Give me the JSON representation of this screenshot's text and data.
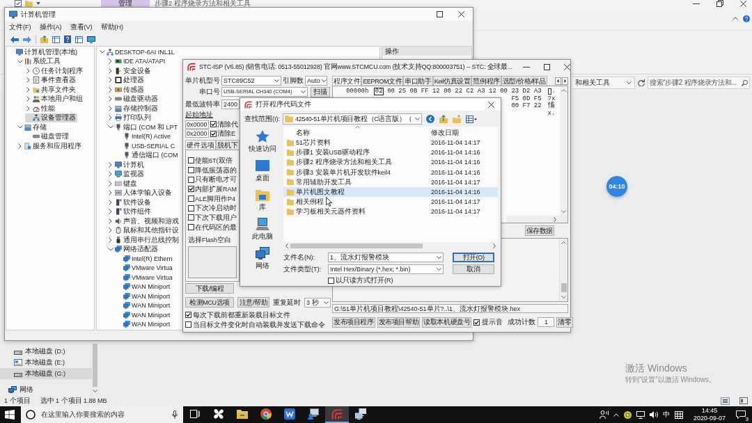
{
  "explorer": {
    "title": "步骤2 程序烧录方法和相关工具",
    "context_tab": "管理",
    "address_text": "和相关工具",
    "search": {
      "placeholder": "搜索“步骤2 程序烧录方法和..."
    },
    "nav_items": [
      {
        "label": "本地磁盘 (D:)",
        "kind": "disk",
        "selected": false
      },
      {
        "label": "本地磁盘 (E:)",
        "kind": "drive",
        "selected": false
      },
      {
        "label": "本地磁盘 (G:)",
        "kind": "disk",
        "selected": true
      },
      {
        "label": "网络",
        "kind": "network",
        "selected": false
      }
    ],
    "status": [
      "1 个项目",
      "选中 1 个项目  1.88 MB"
    ]
  },
  "computer_management": {
    "title": "计算机管理",
    "menu": [
      "文件(F)",
      "操作(A)",
      "查看(V)",
      "帮助(H)"
    ],
    "nav_tree": [
      {
        "label": "计算机管理(本地)",
        "kind": "computer",
        "selected": false,
        "children": [
          {
            "label": "系统工具",
            "kind": "tools",
            "expanded": true,
            "selected": false,
            "children": [
              {
                "label": "任务计划程序",
                "kind": "clock",
                "expanded": false,
                "selected": false
              },
              {
                "label": "事件查看器",
                "kind": "log",
                "expanded": false,
                "selected": false
              },
              {
                "label": "共享文件夹",
                "kind": "share",
                "expanded": false,
                "selected": false
              },
              {
                "label": "本地用户和组",
                "kind": "users",
                "expanded": false,
                "selected": false
              },
              {
                "label": "性能",
                "kind": "gauge",
                "expanded": false,
                "selected": false
              },
              {
                "label": "设备管理器",
                "kind": "devices",
                "selected": true
              }
            ]
          },
          {
            "label": "存储",
            "kind": "storage",
            "expanded": true,
            "selected": false,
            "children": [
              {
                "label": "磁盘管理",
                "kind": "disk",
                "selected": false
              }
            ]
          },
          {
            "label": "服务和应用程序",
            "kind": "services",
            "expanded": false,
            "selected": false
          }
        ]
      }
    ],
    "device_tree": [
      {
        "label": "DESKTOP-6AI INL1L",
        "kind": "devices",
        "expanded": true,
        "children": [
          {
            "label": "IDE ATA/ATAPI",
            "kind": "board",
            "expanded": false
          },
          {
            "label": "安全设备",
            "kind": "security",
            "expanded": false
          },
          {
            "label": "处理器",
            "kind": "chip",
            "expanded": false
          },
          {
            "label": "传感器",
            "kind": "sensor",
            "expanded": false
          },
          {
            "label": "磁盘驱动器",
            "kind": "disk",
            "expanded": false
          },
          {
            "label": "存储控制器",
            "kind": "storage",
            "expanded": false
          },
          {
            "label": "打印队列",
            "kind": "printer",
            "expanded": false
          },
          {
            "label": "端口 (COM 和 LPT",
            "kind": "port",
            "expanded": true,
            "children": [
              {
                "label": "Intel(R) Active",
                "kind": "port"
              },
              {
                "label": "USB-SERIAL C",
                "kind": "port"
              },
              {
                "label": "通信端口 (COM",
                "kind": "port"
              }
            ]
          },
          {
            "label": "计算机",
            "kind": "computer",
            "expanded": false
          },
          {
            "label": "监视器",
            "kind": "monitor",
            "expanded": false
          },
          {
            "label": "键盘",
            "kind": "keyboard",
            "expanded": false
          },
          {
            "label": "人体学输入设备",
            "kind": "hid",
            "expanded": false
          },
          {
            "label": "软件设备",
            "kind": "software",
            "expanded": false
          },
          {
            "label": "软件组件",
            "kind": "software",
            "expanded": false
          },
          {
            "label": "声音、视频和游戏",
            "kind": "speaker",
            "expanded": false
          },
          {
            "label": "鼠标和其他指针设",
            "kind": "mouse",
            "expanded": false
          },
          {
            "label": "通用串行总线控制",
            "kind": "usb",
            "expanded": false
          },
          {
            "label": "网络适配器",
            "kind": "network",
            "expanded": true,
            "children": [
              {
                "label": "Intel(R) Ethern",
                "kind": "network"
              },
              {
                "label": "VMware Virtua",
                "kind": "network"
              },
              {
                "label": "VMware Virtua",
                "kind": "network"
              },
              {
                "label": "WAN Miniport",
                "kind": "network"
              },
              {
                "label": "WAN Miniport",
                "kind": "network"
              },
              {
                "label": "WAN Miniport",
                "kind": "network"
              },
              {
                "label": "WAN Miniport",
                "kind": "network"
              },
              {
                "label": "WAN Miniport",
                "kind": "network"
              }
            ]
          }
        ]
      }
    ],
    "actions_header": "操作"
  },
  "stc_isp": {
    "title": "STC-ISP (V6.85) (销售电话: 0513-55012928) 官网www.STCMCU.com (技术支持QQ:800003751) -- STC: 全球最...",
    "mcu": {
      "label": "单片机型号",
      "value": "STC89C52"
    },
    "pins": {
      "label": "引脚数",
      "value": "Auto"
    },
    "port": {
      "label": "串口号",
      "value": "USB-SERIAL CH340 (COM4)",
      "button": "扫描"
    },
    "baud": {
      "label": "最低波特率",
      "value": "2400"
    },
    "address": {
      "label": "起始地址",
      "rows": [
        {
          "value": "0x0000",
          "option": "清除代",
          "checked": true
        },
        {
          "value": "0x2000",
          "option": "清除E",
          "checked": true
        }
      ]
    },
    "option_tabs": [
      {
        "label": "硬件选项",
        "selected": true
      },
      {
        "label": "脱机下",
        "selected": false
      }
    ],
    "hardware_options": [
      {
        "label": "使能6T(双倍",
        "checked": false
      },
      {
        "label": "降低振荡器的",
        "checked": false
      },
      {
        "label": "只有断电才可",
        "checked": false
      },
      {
        "label": "内部扩展RAM",
        "checked": true
      },
      {
        "label": "ALE脚用作P4",
        "checked": false
      },
      {
        "label": "下次冷启动时",
        "checked": false
      },
      {
        "label": "下次下载用户",
        "checked": false
      },
      {
        "label": "在代码区的最",
        "checked": false
      }
    ],
    "flash_fill": "选择Flash空白",
    "download_button": "下载/编程",
    "check_button": "检测MCU选项",
    "help_button": "注意/帮助",
    "repeat": {
      "label": "重复延时",
      "value": "3 秒"
    },
    "reload_options": [
      {
        "label": "每次下载前都重新装载目标文件",
        "checked": true
      },
      {
        "label": "当目标文件变化时自动装载并发送下载命令",
        "checked": false
      }
    ],
    "file_tabs": [
      {
        "label": "程序文件",
        "selected": true
      },
      {
        "label": "EEPROM文件",
        "selected": false
      },
      {
        "label": "串口助手",
        "selected": false
      },
      {
        "label": "Keil仿真设置",
        "selected": false
      },
      {
        "label": "范例程序",
        "selected": false
      },
      {
        "label": "选型/价格/样品",
        "selected": false
      }
    ],
    "hex_rows": [
      {
        "address": "00000h",
        "cursor_byte": "02",
        "bytes": "00 25 0B FF 12 00 22 C2 A3 12 00 23 D2 A3",
        "ascii": "."
      },
      {
        "bytes": "F5 0D F5",
        "ascii": "?x"
      },
      {
        "bytes": "00 F7 22",
        "ascii": "慉"
      },
      {
        "ascii": "x."
      }
    ],
    "save_button": "保存数据",
    "file_path": "G:\\51单片机项目教程\\42540-51单片?..\\1、流水灯报警模块.hex",
    "publish_buttons": [
      "发布项目程序",
      "发布项目帮助",
      "读取本机硬盘号"
    ],
    "beep": {
      "label": "提示音",
      "checked": true
    },
    "counter": {
      "label": "成功计数",
      "value": "1",
      "button": "清零"
    }
  },
  "open_dialog": {
    "title": "打开程序代码文件",
    "look_in": {
      "label": "查找范围(I):",
      "value": "42540-51单片机项目教程（C语言版）（"
    },
    "places": [
      {
        "label": "快速访问",
        "kind": "star"
      },
      {
        "label": "桌面",
        "kind": "desktop"
      },
      {
        "label": "库",
        "kind": "library"
      },
      {
        "label": "此电脑",
        "kind": "computer"
      },
      {
        "label": "网络",
        "kind": "network"
      }
    ],
    "columns": [
      "名称",
      "修改日期"
    ],
    "files": [
      {
        "name": "51芯片资料",
        "modified": "2016-11-04 14:17",
        "selected": false
      },
      {
        "name": "步骤1 安装USB驱动程序",
        "modified": "2016-11-04 14:16",
        "selected": false
      },
      {
        "name": "步骤2 程序烧录方法和相关工具",
        "modified": "2016-11-04 14:16",
        "selected": false
      },
      {
        "name": "步骤3 安装单片机开发软件keil4",
        "modified": "2016-11-04 14:16",
        "selected": false
      },
      {
        "name": "常用辅助开发工具",
        "modified": "2016-11-04 14:17",
        "selected": false
      },
      {
        "name": "单片机图文教程",
        "modified": "2016-11-04 14:16",
        "selected": true
      },
      {
        "name": "相关例程",
        "modified": "2016-11-04 14:17",
        "selected": false
      },
      {
        "name": "学习板相关元器件资料",
        "modified": "2016-11-04 14:17",
        "selected": false
      }
    ],
    "file_name": {
      "label": "文件名(N):",
      "value": "1、流水灯报警模块"
    },
    "file_type": {
      "label": "文件类型(T):",
      "value": "Intel Hex/Binary (*.hex; *.bin)"
    },
    "read_only": {
      "label": "以只读方式打开(R)",
      "checked": false
    },
    "buttons": [
      {
        "label": "打开(O)",
        "kind": "default"
      },
      {
        "label": "取消",
        "kind": "normal"
      }
    ]
  },
  "recording_timer": "04:10",
  "activation_notice": {
    "title": "激活 Windows",
    "hint": "转到“设置”以激活 Windows。"
  },
  "taskbar": {
    "search": {
      "placeholder": "在这里输入你要搜索的内容"
    },
    "apps": [
      {
        "kind": "task-view",
        "active": false
      },
      {
        "kind": "pinwheel",
        "active": false
      },
      {
        "kind": "folder",
        "active": false
      },
      {
        "kind": "browser",
        "active": false
      },
      {
        "kind": "writer",
        "active": false
      },
      {
        "kind": "remote",
        "active": false
      },
      {
        "kind": "stc",
        "active": true
      },
      {
        "kind": "network",
        "active": false
      }
    ],
    "ime": "中",
    "time": "14:45",
    "date": "2020-09-07",
    "notifications": "3"
  }
}
